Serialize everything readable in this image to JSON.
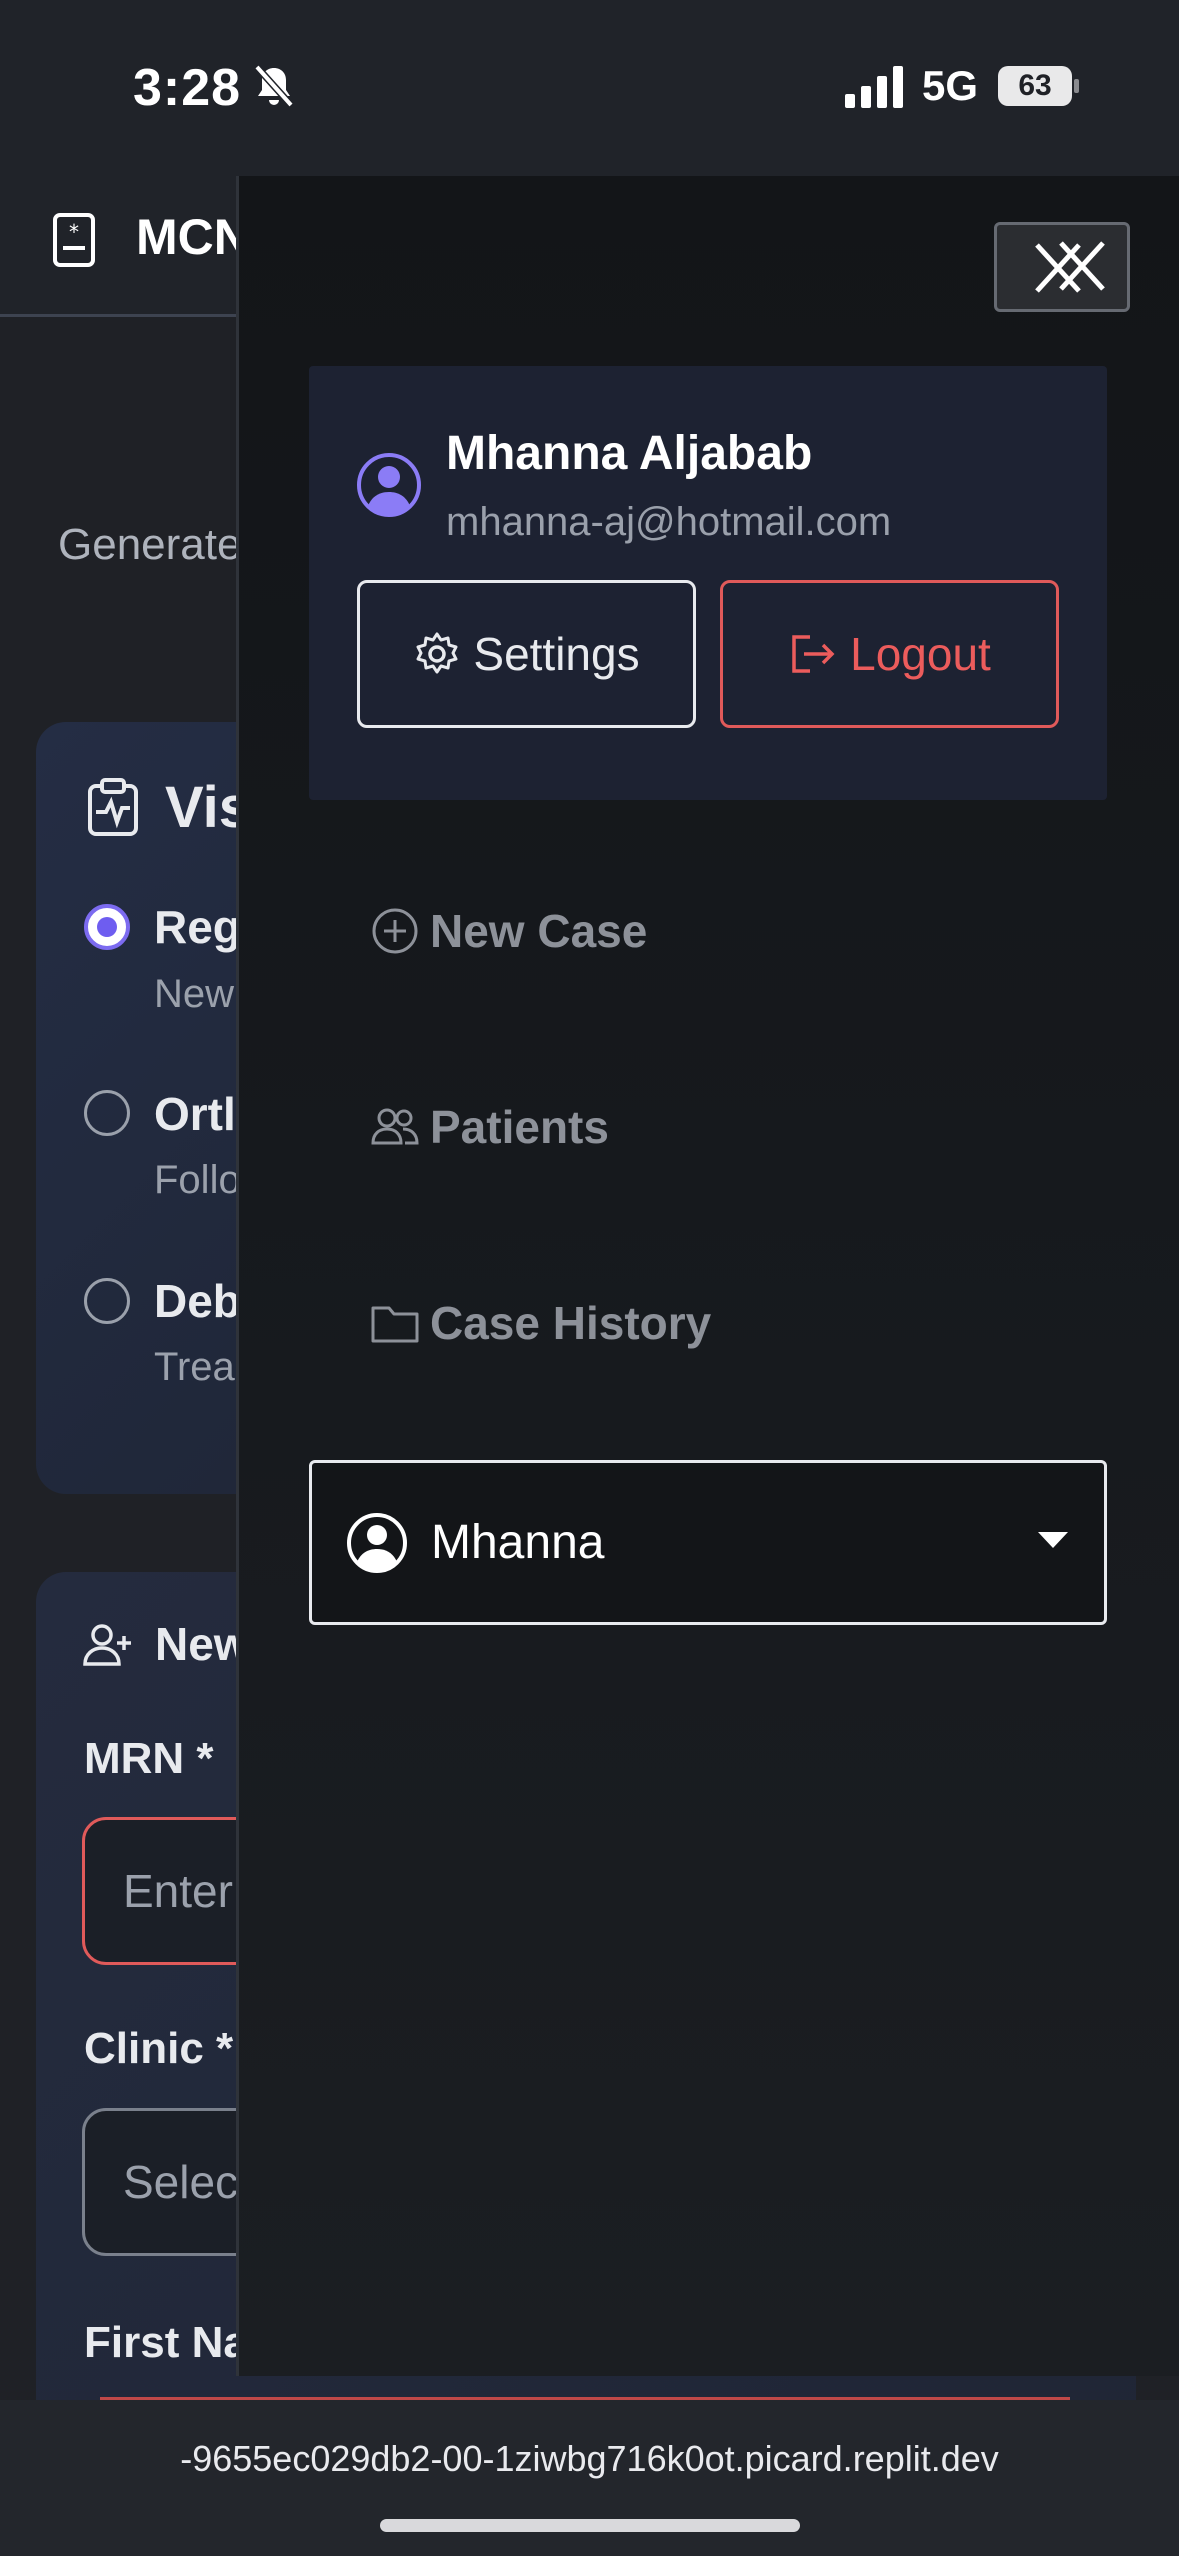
{
  "status_bar": {
    "time": "3:28",
    "network": "5G",
    "battery": "63"
  },
  "app": {
    "title": "MCN",
    "subtitle": "Generate",
    "visit_card": {
      "title": "Vis",
      "options": [
        {
          "title": "Reg",
          "subtitle": "New",
          "selected": true
        },
        {
          "title": "Ortl",
          "subtitle": "Follo",
          "selected": false
        },
        {
          "title": "Deb",
          "subtitle": "Trea",
          "selected": false
        }
      ]
    },
    "patient_card": {
      "title": "New",
      "mrn_label": "MRN *",
      "mrn_placeholder": "Enter",
      "clinic_label": "Clinic *",
      "clinic_placeholder": "Selec",
      "first_name_label": "First Na"
    }
  },
  "drawer": {
    "user": {
      "name": "Mhanna Aljabab",
      "email": "mhanna-aj@hotmail.com"
    },
    "settings_label": "Settings",
    "logout_label": "Logout",
    "nav": {
      "new_case": "New Case",
      "patients": "Patients",
      "case_history": "Case History"
    },
    "profile_select": {
      "selected": "Mhanna"
    }
  },
  "browser": {
    "url": "-9655ec029db2-00-1ziwbg716k0ot.picard.replit.dev"
  },
  "colors": {
    "accent": "#7c6bf0",
    "danger": "#e05a5a",
    "drawer_bg": "#16191d",
    "card_bg": "#1d2232"
  }
}
